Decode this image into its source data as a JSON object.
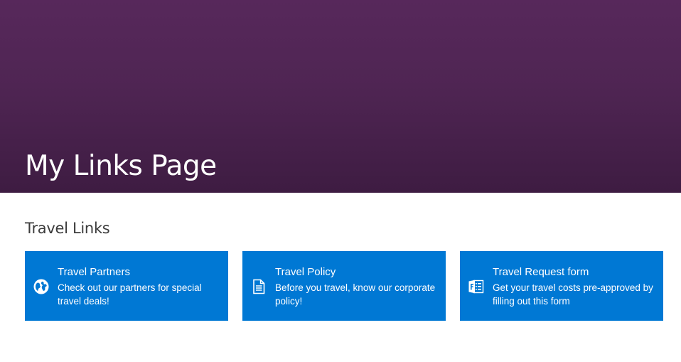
{
  "page": {
    "title": "My Links Page",
    "colors": {
      "header_background": "#4f2553",
      "tile_background": "#0078d4"
    }
  },
  "section": {
    "title": "Travel Links"
  },
  "tiles": [
    {
      "title": "Travel Partners",
      "description": "Check out our partners for special travel deals!",
      "icon": "globe-icon"
    },
    {
      "title": "Travel Policy",
      "description": "Before you travel, know our corporate policy!",
      "icon": "document-icon"
    },
    {
      "title": "Travel Request form",
      "description": "Get your travel costs pre-approved by filling out this form",
      "icon": "forms-icon"
    }
  ]
}
